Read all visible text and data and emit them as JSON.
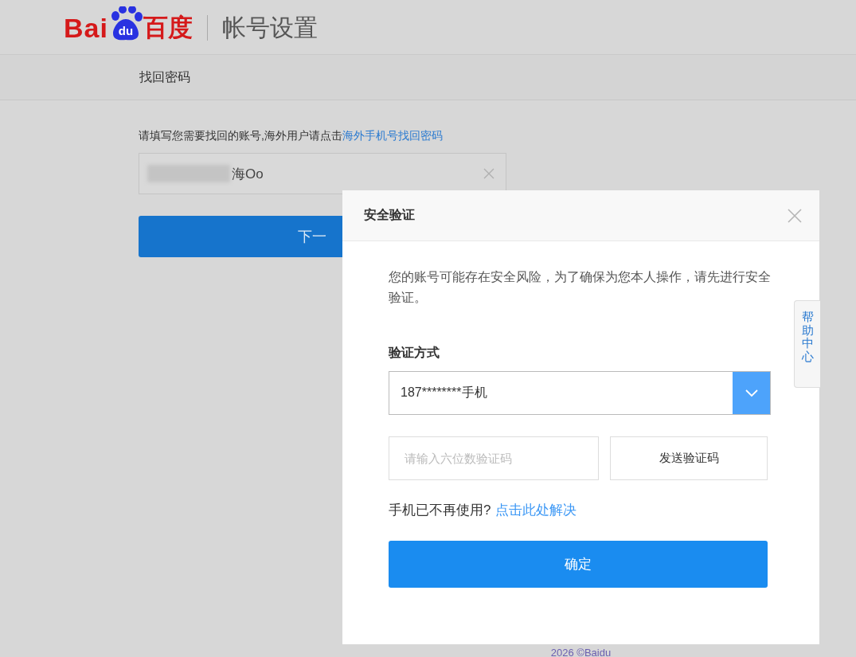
{
  "header": {
    "logo": {
      "latin": "Bai",
      "paw": "du",
      "chinese": "百度"
    },
    "section_title": "帐号设置"
  },
  "subnav": {
    "title": "找回密码"
  },
  "form": {
    "instruction": "请填写您需要找回的账号,海外用户请点击",
    "instruction_link": "海外手机号找回密码",
    "account_field": {
      "value": "海Oo"
    },
    "next_button": "下一"
  },
  "dialog": {
    "title": "安全验证",
    "message": "您的账号可能存在安全风险，为了确保为您本人操作，请先进行安全验证。",
    "method_label": "验证方式",
    "method_select": {
      "value": "187********手机"
    },
    "code_field": {
      "placeholder": "请输入六位数验证码"
    },
    "send_button": "发送验证码",
    "lost_phone_text": "手机已不再使用?",
    "lost_phone_link": "点击此处解决",
    "confirm_button": "确定"
  },
  "help_tab": "帮助中心",
  "footer": "2026 ©Baidu"
}
